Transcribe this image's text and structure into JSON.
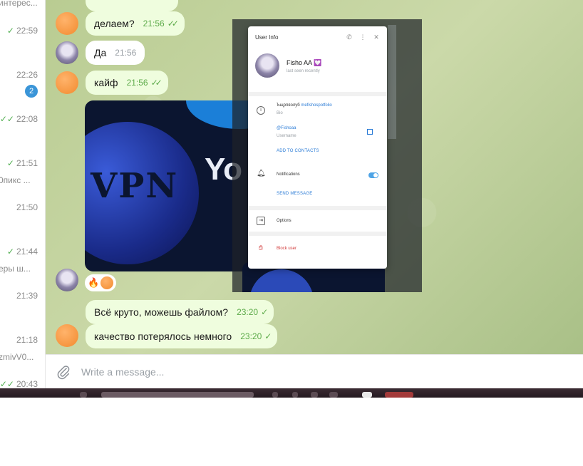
{
  "chat_list": {
    "badge": "2",
    "items": [
      {
        "time": "",
        "snippet": "интерес...",
        "read": false
      },
      {
        "time": "22:59",
        "read": true,
        "double": false
      },
      {
        "time": "22:26",
        "read": false
      },
      {
        "time": "22:08",
        "read": true,
        "double": true
      },
      {
        "time": "21:51",
        "read": true,
        "double": false
      },
      {
        "snippet": "0пикс ..."
      },
      {
        "time": "21:50",
        "read": false
      },
      {
        "time": "21:44",
        "read": true,
        "double": false
      },
      {
        "snippet": "еры ш..."
      },
      {
        "time": "21:39",
        "read": false
      },
      {
        "time": "21:18",
        "read": false
      },
      {
        "snippet": "zmivV0..."
      },
      {
        "time": "20:43",
        "read": true,
        "double": true
      }
    ]
  },
  "messages": [
    {
      "text": "делаем?",
      "time": "21:56",
      "ticks": "✓✓",
      "direction": "out"
    },
    {
      "text": "Да",
      "time": "21:56",
      "direction": "in"
    },
    {
      "text": "кайф",
      "time": "21:56",
      "ticks": "✓✓",
      "direction": "out"
    },
    {
      "text": "Всё круто, можешь файлом?",
      "time": "23:20",
      "ticks": "✓",
      "direction": "out"
    },
    {
      "text": "качество потерялось немного",
      "time": "23:20",
      "ticks": "✓",
      "direction": "out"
    }
  ],
  "media": {
    "text_vpn": "VPN",
    "text_overlay": "Yo"
  },
  "reactions": {
    "emoji": "🔥"
  },
  "composer": {
    "placeholder": "Write a message..."
  },
  "user_info": {
    "title": "User Info",
    "name": "Fisho AA 💟",
    "status": "last seen recently",
    "bio_prefix": "Ъщрпяолуб ",
    "bio_link": "mefishospotfolio",
    "bio_label": "Bio",
    "username": "@Fishoaa",
    "username_label": "Username",
    "add_contacts": "ADD TO CONTACTS",
    "notifications": "Notifications",
    "send_message": "SEND MESSAGE",
    "options": "Options",
    "block": "Block user"
  }
}
